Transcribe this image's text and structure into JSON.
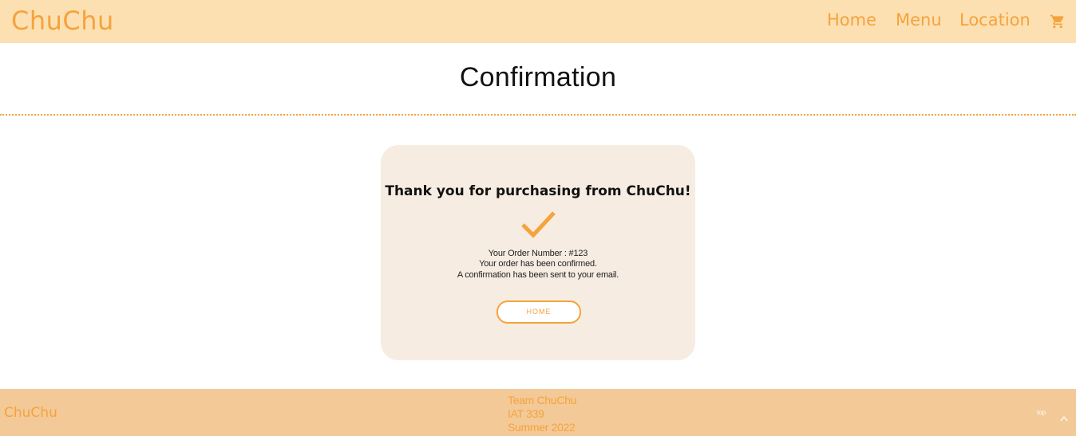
{
  "navbar": {
    "brand": "ChuChu",
    "links": [
      "Home",
      "Menu",
      "Location"
    ],
    "cart_icon": "shopping-cart-icon"
  },
  "page": {
    "title": "Confirmation"
  },
  "confirmation_card": {
    "heading": "Thank you for purchasing from ChuChu!",
    "check_icon": "checkmark-icon",
    "order_number": "Your Order Number : #123",
    "status": "Your order has been confirmed.",
    "email_notice": "A confirmation has been sent to your email.",
    "home_button": "HOME"
  },
  "footer": {
    "brand": "ChuChu",
    "team": "Team ChuChu",
    "course": "IAT 339",
    "term": "Summer 2022",
    "top_label": "top",
    "top_icon": "chevron-up-icon"
  },
  "colors": {
    "accent": "#f5a33c",
    "navbar_bg": "#fde0b2",
    "card_bg": "#f7ece2",
    "footer_bg": "#f3c997"
  }
}
